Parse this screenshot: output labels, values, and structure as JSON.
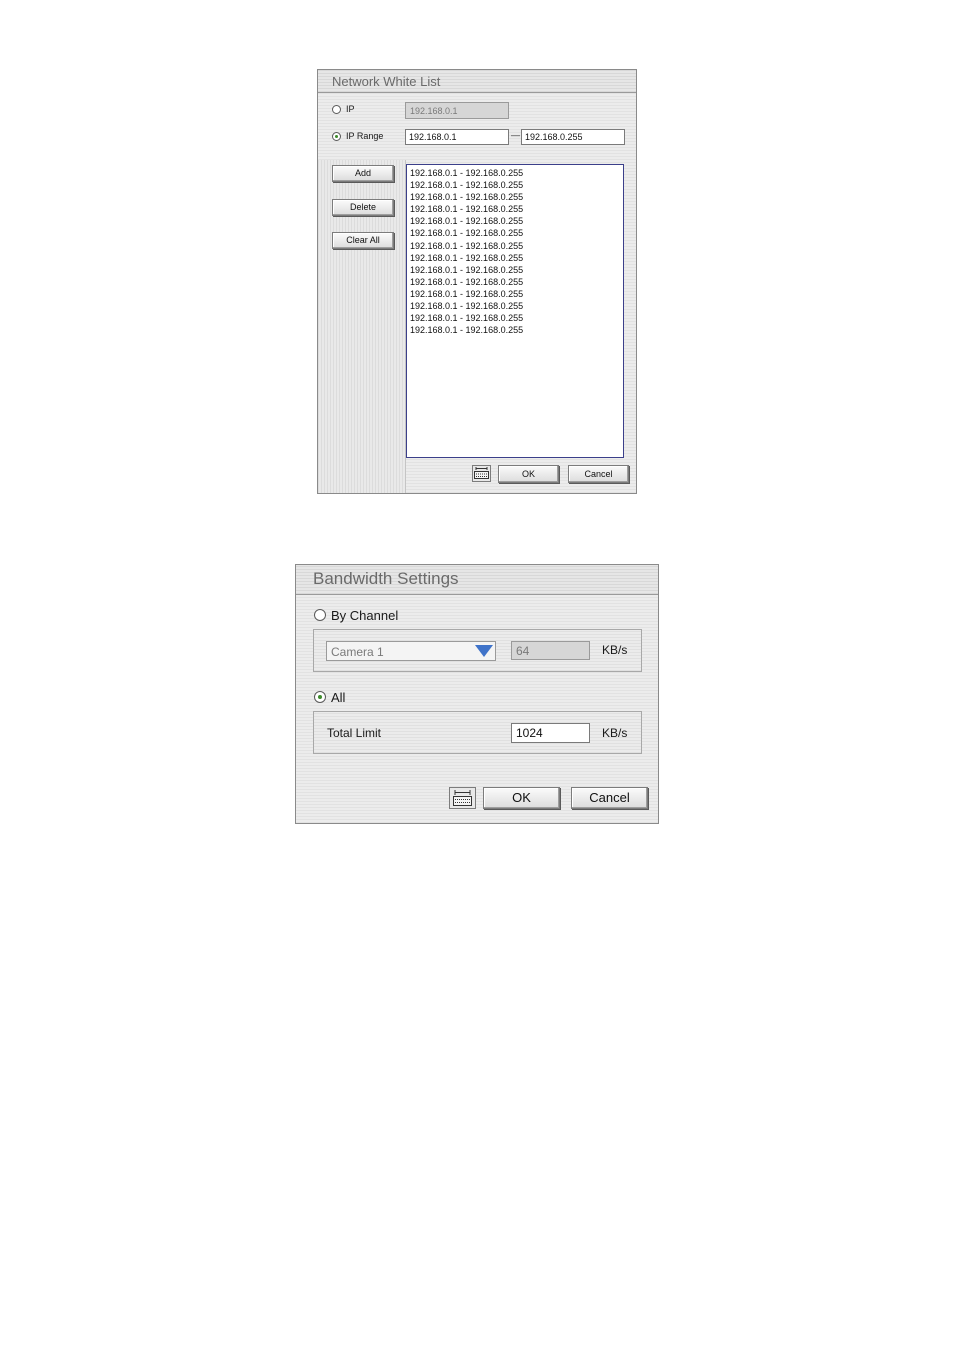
{
  "network_white_list": {
    "title": "Network White List",
    "ip_option": {
      "label": "IP",
      "selected": false,
      "value": "192.168.0.1"
    },
    "ip_range_option": {
      "label": "IP Range",
      "selected": true,
      "separator": "—",
      "start": "192.168.0.1",
      "end": "192.168.0.255"
    },
    "buttons": {
      "add": "Add",
      "delete": "Delete",
      "clear_all": "Clear All",
      "ok": "OK",
      "cancel": "Cancel"
    },
    "keyboard_icon": "keyboard-icon",
    "entries": [
      "192.168.0.1 - 192.168.0.255",
      "192.168.0.1 - 192.168.0.255",
      "192.168.0.1 - 192.168.0.255",
      "192.168.0.1 - 192.168.0.255",
      "192.168.0.1 - 192.168.0.255",
      "192.168.0.1 - 192.168.0.255",
      "192.168.0.1 - 192.168.0.255",
      "192.168.0.1 - 192.168.0.255",
      "192.168.0.1 - 192.168.0.255",
      "192.168.0.1 - 192.168.0.255",
      "192.168.0.1 - 192.168.0.255",
      "192.168.0.1 - 192.168.0.255",
      "192.168.0.1 - 192.168.0.255",
      "192.168.0.1 - 192.168.0.255"
    ]
  },
  "bandwidth_settings": {
    "title": "Bandwidth Settings",
    "by_channel": {
      "label": "By Channel",
      "selected": false,
      "channel": "Camera 1",
      "value": "64",
      "unit": "KB/s"
    },
    "all": {
      "label": "All",
      "selected": true,
      "total_label": "Total Limit",
      "value": "1024",
      "unit": "KB/s"
    },
    "buttons": {
      "ok": "OK",
      "cancel": "Cancel"
    },
    "keyboard_icon": "keyboard-icon"
  },
  "colors": {
    "radio_selected": "#3c8a2a",
    "list_border": "#3b3f8a",
    "dropdown_arrow": "#3f73c9"
  }
}
